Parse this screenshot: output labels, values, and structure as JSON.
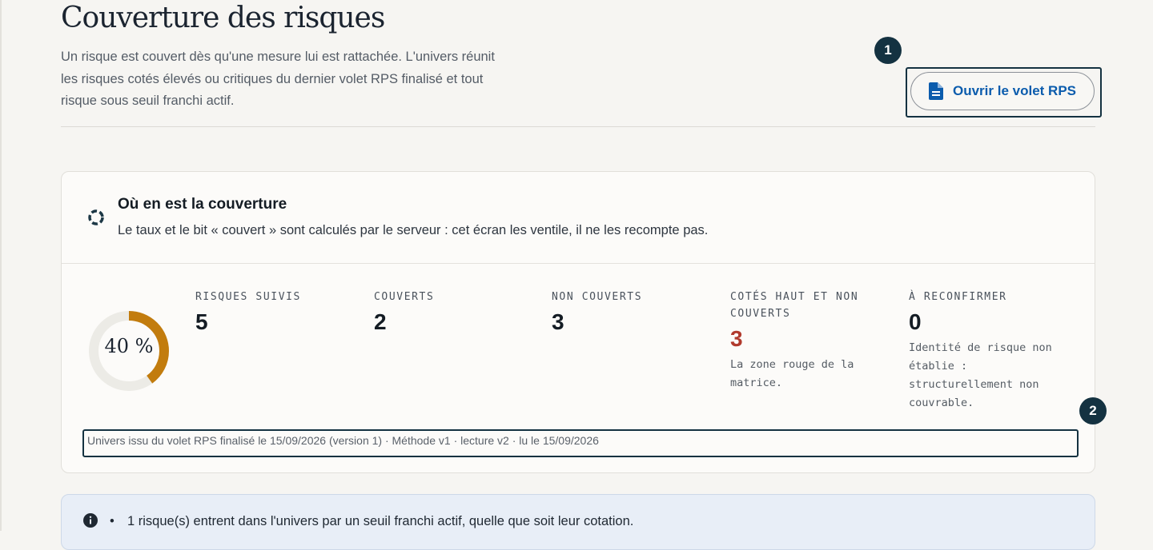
{
  "page": {
    "title": "Couverture des risques",
    "intro": "Un risque est couvert dès qu'une mesure lui est rattachée. L'univers réunit les risques cotés élevés ou critiques du dernier volet RPS finalisé et tout risque sous seuil franchi actif."
  },
  "action": {
    "open_label": "Ouvrir le volet RPS",
    "icon": "document-icon",
    "badge": "1"
  },
  "coverage": {
    "title": "Où en est la couverture",
    "subtitle": "Le taux et le bit « couvert » sont calculés par le serveur : cet écran les ventile, il ne les recompte pas.",
    "rate_label": "40 %",
    "rate": 0.4,
    "colors": {
      "progress": "#c27c0e",
      "track": "#ecebe6",
      "alert": "#b13a2d"
    },
    "stats": [
      {
        "label": "RISQUES SUIVIS",
        "value": "5",
        "note": ""
      },
      {
        "label": "COUVERTS",
        "value": "2",
        "note": ""
      },
      {
        "label": "NON COUVERTS",
        "value": "3",
        "note": ""
      },
      {
        "label": "COTÉS HAUT ET NON COUVERTS",
        "value": "3",
        "note": "La zone rouge de la matrice."
      },
      {
        "label": "À RECONFIRMER",
        "value": "0",
        "note": "Identité de risque non établie : structurellement non couvrable."
      }
    ],
    "meta": "Univers issu du volet RPS finalisé le 15/09/2026 (version 1) · Méthode v1 · lecture v2 · lu le 15/09/2026",
    "badge": "2"
  },
  "info": {
    "items": [
      "1 risque(s) entrent dans l'univers par un seuil franchi actif, quelle que soit leur cotation."
    ]
  }
}
